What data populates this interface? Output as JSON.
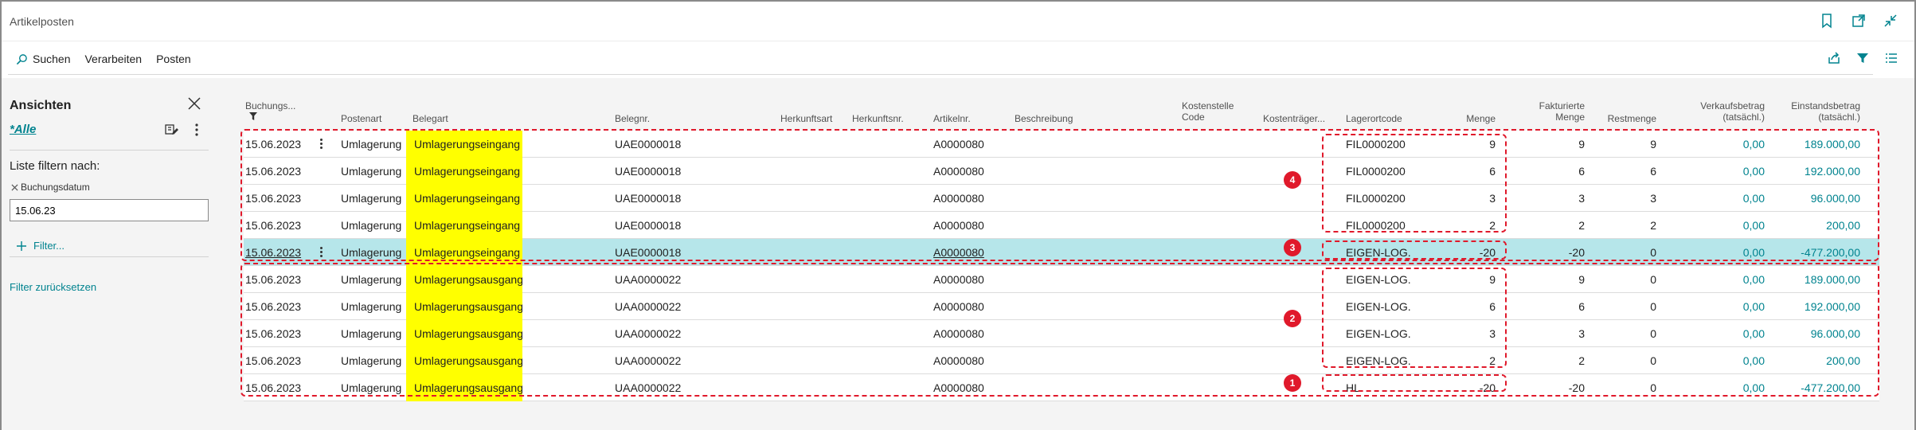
{
  "window": {
    "title": "Artikelposten"
  },
  "toolbar": {
    "search": "Suchen",
    "process": "Verarbeiten",
    "entries": "Posten"
  },
  "views": {
    "heading": "Ansichten",
    "all_label": "*Alle",
    "filter_heading": "Liste filtern nach:",
    "filter_field": "Buchungsdatum",
    "filter_value": "15.06.23",
    "add_filter": "Filter...",
    "reset_filter": "Filter zurücksetzen"
  },
  "table": {
    "headers": {
      "date": "Buchungs...",
      "entry_type": "Postenart",
      "doc_type": "Belegart",
      "doc_no": "Belegnr.",
      "source_type": "Herkunftsart",
      "source_no": "Herkunftsnr.",
      "item_no": "Artikelnr.",
      "description": "Beschreibung",
      "cost_center_1": "Kostenstelle",
      "cost_center_2": "Code",
      "cost_unit": "Kostenträger...",
      "location": "Lagerortcode",
      "qty": "Menge",
      "inv_qty_1": "Fakturierte",
      "inv_qty_2": "Menge",
      "rem_qty": "Restmenge",
      "sales_1": "Verkaufsbetrag",
      "sales_2": "(tatsächl.)",
      "cost_1": "Einstandsbetrag",
      "cost_2": "(tatsächl.)"
    },
    "rows": [
      {
        "date": "15.06.2023",
        "entry_type": "Umlagerung",
        "doc_type": "Umlagerungseingang",
        "doc_no": "UAE0000018",
        "item_no": "A0000080",
        "location": "FIL0000200",
        "qty": "9",
        "inv_qty": "9",
        "rem_qty": "9",
        "sales": "0,00",
        "cost": "189.000,00"
      },
      {
        "date": "15.06.2023",
        "entry_type": "Umlagerung",
        "doc_type": "Umlagerungseingang",
        "doc_no": "UAE0000018",
        "item_no": "A0000080",
        "location": "FIL0000200",
        "qty": "6",
        "inv_qty": "6",
        "rem_qty": "6",
        "sales": "0,00",
        "cost": "192.000,00"
      },
      {
        "date": "15.06.2023",
        "entry_type": "Umlagerung",
        "doc_type": "Umlagerungseingang",
        "doc_no": "UAE0000018",
        "item_no": "A0000080",
        "location": "FIL0000200",
        "qty": "3",
        "inv_qty": "3",
        "rem_qty": "3",
        "sales": "0,00",
        "cost": "96.000,00"
      },
      {
        "date": "15.06.2023",
        "entry_type": "Umlagerung",
        "doc_type": "Umlagerungseingang",
        "doc_no": "UAE0000018",
        "item_no": "A0000080",
        "location": "FIL0000200",
        "qty": "2",
        "inv_qty": "2",
        "rem_qty": "2",
        "sales": "0,00",
        "cost": "200,00"
      },
      {
        "date": "15.06.2023",
        "entry_type": "Umlagerung",
        "doc_type": "Umlagerungseingang",
        "doc_no": "UAE0000018",
        "item_no": "A0000080",
        "location": "EIGEN-LOG.",
        "qty": "-20",
        "inv_qty": "-20",
        "rem_qty": "0",
        "sales": "0,00",
        "cost": "-477.200,00"
      },
      {
        "date": "15.06.2023",
        "entry_type": "Umlagerung",
        "doc_type": "Umlagerungsausgang",
        "doc_no": "UAA0000022",
        "item_no": "A0000080",
        "location": "EIGEN-LOG.",
        "qty": "9",
        "inv_qty": "9",
        "rem_qty": "0",
        "sales": "0,00",
        "cost": "189.000,00"
      },
      {
        "date": "15.06.2023",
        "entry_type": "Umlagerung",
        "doc_type": "Umlagerungsausgang",
        "doc_no": "UAA0000022",
        "item_no": "A0000080",
        "location": "EIGEN-LOG.",
        "qty": "6",
        "inv_qty": "6",
        "rem_qty": "0",
        "sales": "0,00",
        "cost": "192.000,00"
      },
      {
        "date": "15.06.2023",
        "entry_type": "Umlagerung",
        "doc_type": "Umlagerungsausgang",
        "doc_no": "UAA0000022",
        "item_no": "A0000080",
        "location": "EIGEN-LOG.",
        "qty": "3",
        "inv_qty": "3",
        "rem_qty": "0",
        "sales": "0,00",
        "cost": "96.000,00"
      },
      {
        "date": "15.06.2023",
        "entry_type": "Umlagerung",
        "doc_type": "Umlagerungsausgang",
        "doc_no": "UAA0000022",
        "item_no": "A0000080",
        "location": "EIGEN-LOG.",
        "qty": "2",
        "inv_qty": "2",
        "rem_qty": "0",
        "sales": "0,00",
        "cost": "200,00"
      },
      {
        "date": "15.06.2023",
        "entry_type": "Umlagerung",
        "doc_type": "Umlagerungsausgang",
        "doc_no": "UAA0000022",
        "item_no": "A0000080",
        "location": "HL",
        "qty": "-20",
        "inv_qty": "-20",
        "rem_qty": "0",
        "sales": "0,00",
        "cost": "-477.200,00"
      }
    ]
  },
  "annotations": {
    "b1": "1",
    "b2": "2",
    "b3": "3",
    "b4": "4"
  },
  "colors": {
    "accent": "#00838f",
    "highlight": "#ffff00",
    "selected_row": "#b6e6ea",
    "annotation": "#e0192b"
  },
  "icons": [
    "search-icon",
    "bookmark-icon",
    "open-new-window-icon",
    "collapse-icon",
    "share-icon",
    "filter-icon",
    "list-icon",
    "close-icon",
    "edit-view-icon",
    "more-options-icon",
    "plus-icon"
  ]
}
